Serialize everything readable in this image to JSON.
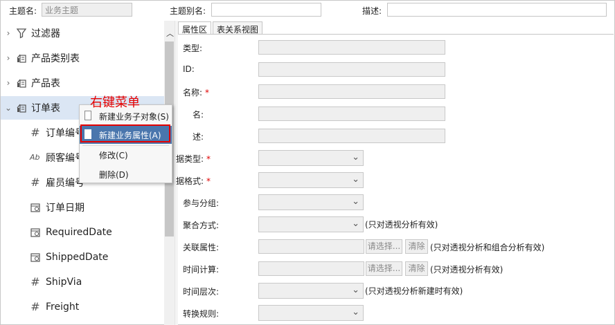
{
  "topbar": {
    "subject_name_label": "主题名:",
    "subject_name_value": "业务主题",
    "alias_label": "主题别名:",
    "alias_value": "",
    "desc_label": "描述:",
    "desc_value": ""
  },
  "tree": {
    "items": [
      {
        "label": "过滤器"
      },
      {
        "label": "产品类别表"
      },
      {
        "label": "产品表"
      },
      {
        "label": "订单表"
      }
    ],
    "children": [
      {
        "label": "订单编号"
      },
      {
        "label": "顾客编号"
      },
      {
        "label": "雇员编号"
      },
      {
        "label": "订单日期"
      },
      {
        "label": "RequiredDate"
      },
      {
        "label": "ShippedDate"
      },
      {
        "label": "ShipVia"
      },
      {
        "label": "Freight"
      }
    ]
  },
  "tabs": [
    {
      "label": "属性区"
    },
    {
      "label": "表关系视图"
    }
  ],
  "form": {
    "type_label": "类型:",
    "id_label": "ID:",
    "name_label": "名称:",
    "alias_label": "名:",
    "desc_label": "述:",
    "datatype_label": "据类型:",
    "dataformat_label": "据格式:",
    "group_label": "参与分组:",
    "agg_label": "聚合方式:",
    "agg_note": "(只对透视分析有效)",
    "rel_label": "关联属性:",
    "rel_note": "(只对透视分析和组合分析有效)",
    "time_label": "时间计算:",
    "time_note": "(只对透视分析有效)",
    "level_label": "时间层次:",
    "level_note": "(只对透视分析新建时有效)",
    "conv_label": "转换规则:",
    "required_mark": "*",
    "select_button": "请选择...",
    "clear_button": "清除"
  },
  "context_menu": {
    "annotation": "右键菜单",
    "items": [
      {
        "label": "新建业务子对象(S)"
      },
      {
        "label": "新建业务属性(A)"
      },
      {
        "label": "修改(C)"
      },
      {
        "label": "删除(D)"
      }
    ]
  },
  "colors": {
    "highlight": "#4a76ad",
    "annotation": "#e60000",
    "required": "#e00000"
  }
}
